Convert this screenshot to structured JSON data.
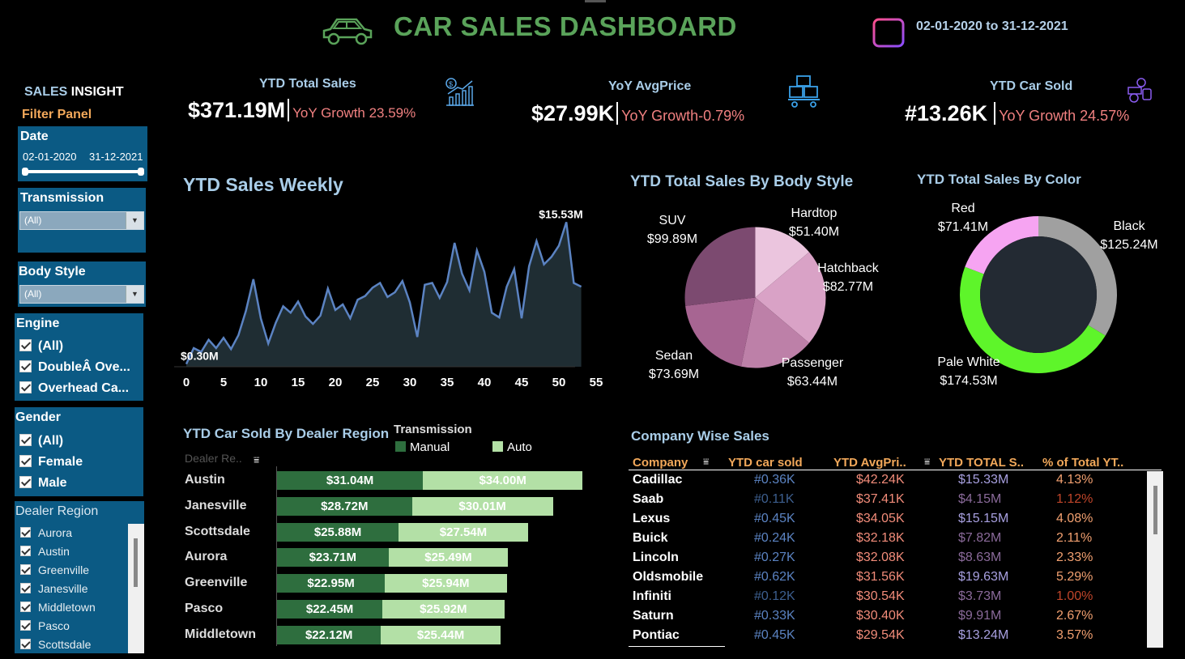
{
  "header": {
    "title": "CAR SALES DASHBOARD",
    "date_range": "02-01-2020 to 31-12-2021"
  },
  "sidebar": {
    "insight_prefix": "SALES",
    "insight_suffix": "INSIGHT",
    "filter_title": "Filter Panel",
    "date": {
      "label": "Date",
      "start": "02-01-2020",
      "end": "31-12-2021"
    },
    "transmission": {
      "label": "Transmission",
      "value": "(All)"
    },
    "body_style": {
      "label": "Body Style",
      "value": "(All)"
    },
    "engine": {
      "label": "Engine",
      "options": [
        "(All)",
        "DoubleÂ Ove...",
        "Overhead Ca..."
      ]
    },
    "gender": {
      "label": "Gender",
      "options": [
        "(All)",
        "Female",
        "Male"
      ]
    },
    "dealer_region": {
      "label": "Dealer Region",
      "options": [
        "Aurora",
        "Austin",
        "Greenville",
        "Janesville",
        "Middletown",
        "Pasco",
        "Scottsdale"
      ]
    }
  },
  "kpis": [
    {
      "label": "YTD Total Sales",
      "value": "$371.19M",
      "growth": "YoY Growth 23.59%"
    },
    {
      "label": "YoY AvgPrice",
      "value": "$27.99K",
      "growth": "YoY Growth-0.79%"
    },
    {
      "label": "YTD Car Sold",
      "value": "#13.26K",
      "growth": "YoY Growth 24.57%"
    }
  ],
  "colors": {
    "title_green": "#5aa35a",
    "label_blue": "#a9cde8",
    "growth_red": "#f08080",
    "manual": "#2e6e3e",
    "auto": "#b3e0a6",
    "filter_bg": "#0b5a84"
  },
  "chart_data": [
    {
      "type": "area",
      "title": "YTD Sales Weekly",
      "xlim": [
        0,
        55
      ],
      "xticks": [
        "0",
        "5",
        "10",
        "15",
        "20",
        "25",
        "30",
        "35",
        "40",
        "45",
        "50",
        "55"
      ],
      "y_unit": "M",
      "ylim": [
        0,
        16
      ],
      "min_label": "$0.30M",
      "max_label": "$15.53M",
      "x": [
        0,
        1,
        2,
        3,
        4,
        5,
        6,
        7,
        8,
        9,
        10,
        11,
        12,
        13,
        14,
        15,
        16,
        17,
        18,
        19,
        20,
        21,
        22,
        23,
        24,
        25,
        26,
        27,
        28,
        29,
        30,
        31,
        32,
        33,
        34,
        35,
        36,
        37,
        38,
        39,
        40,
        41,
        42,
        43,
        44,
        45,
        46,
        47,
        48,
        49,
        50,
        51,
        52,
        53
      ],
      "values": [
        0.3,
        2.0,
        1.6,
        2.9,
        2.0,
        3.1,
        1.9,
        3.4,
        6.0,
        9.4,
        5.2,
        2.5,
        4.7,
        6.5,
        5.8,
        7.0,
        5.4,
        4.6,
        5.5,
        8.4,
        6.1,
        6.7,
        5.2,
        7.2,
        7.6,
        8.5,
        9.0,
        7.5,
        8.0,
        9.2,
        6.9,
        3.2,
        8.8,
        9.0,
        7.4,
        9.1,
        13.3,
        10.0,
        8.2,
        12.5,
        10.2,
        5.8,
        5.3,
        8.6,
        10.5,
        5.2,
        10.8,
        13.5,
        11.0,
        11.8,
        13.0,
        15.53,
        9.0,
        8.6
      ]
    },
    {
      "type": "pie",
      "title": "YTD Total Sales By Body Style",
      "categories": [
        "Hardtop",
        "Hatchback",
        "Passenger",
        "Sedan",
        "SUV"
      ],
      "values": [
        51.4,
        82.77,
        63.44,
        73.69,
        99.89
      ],
      "labels": [
        "$51.40M",
        "$82.77M",
        "$63.44M",
        "$73.69M",
        "$99.89M"
      ],
      "colors": [
        "#ebc5de",
        "#d9a2c6",
        "#bd80a8",
        "#a76592",
        "#7c4a70"
      ]
    },
    {
      "type": "pie",
      "title": "YTD Total Sales By Color",
      "categories": [
        "Black",
        "Pale White",
        "Red"
      ],
      "values": [
        125.24,
        174.53,
        71.41
      ],
      "labels": [
        "$125.24M",
        "$174.53M",
        "$71.41M"
      ],
      "colors": [
        "#a0a0a0",
        "#5ef52a",
        "#f6a4f2"
      ]
    },
    {
      "type": "bar",
      "title": "YTD Car Sold By Dealer Region",
      "column_header": "Dealer Re..",
      "legend_title": "Transmission",
      "categories": [
        "Austin",
        "Janesville",
        "Scottsdale",
        "Aurora",
        "Greenville",
        "Pasco",
        "Middletown"
      ],
      "series": [
        {
          "name": "Manual",
          "values": [
            31.04,
            28.72,
            25.88,
            23.71,
            22.95,
            22.45,
            22.12
          ],
          "labels": [
            "$31.04M",
            "$28.72M",
            "$25.88M",
            "$23.71M",
            "$22.95M",
            "$22.45M",
            "$22.12M"
          ]
        },
        {
          "name": "Auto",
          "values": [
            34.0,
            30.01,
            27.54,
            25.49,
            25.94,
            25.92,
            25.44
          ],
          "labels": [
            "$34.00M",
            "$30.01M",
            "$27.54M",
            "$25.49M",
            "$25.94M",
            "$25.92M",
            "$25.44M"
          ]
        }
      ]
    }
  ],
  "company_table": {
    "title": "Company Wise Sales",
    "headers": [
      "Company",
      "YTD car sold",
      "YTD AvgPri..",
      "YTD TOTAL S..",
      "% of Total YT.."
    ],
    "rows": [
      [
        "Cadillac",
        "#0.36K",
        "$42.24K",
        "$15.33M",
        "4.13%"
      ],
      [
        "Saab",
        "#0.11K",
        "$37.41K",
        "$4.15M",
        "1.12%"
      ],
      [
        "Lexus",
        "#0.45K",
        "$34.05K",
        "$15.15M",
        "4.08%"
      ],
      [
        "Buick",
        "#0.24K",
        "$32.18K",
        "$7.82M",
        "2.11%"
      ],
      [
        "Lincoln",
        "#0.27K",
        "$32.08K",
        "$8.63M",
        "2.33%"
      ],
      [
        "Oldsmobile",
        "#0.62K",
        "$31.56K",
        "$19.63M",
        "5.29%"
      ],
      [
        "Infiniti",
        "#0.12K",
        "$30.54K",
        "$3.73M",
        "1.00%"
      ],
      [
        "Saturn",
        "#0.33K",
        "$30.40K",
        "$9.91M",
        "2.67%"
      ],
      [
        "Pontiac",
        "#0.45K",
        "$29.54K",
        "$13.24M",
        "3.57%"
      ]
    ]
  }
}
